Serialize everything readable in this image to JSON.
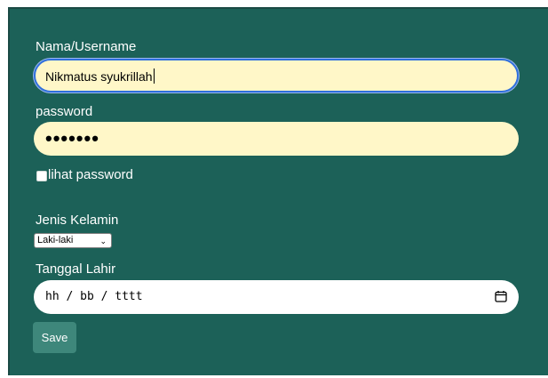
{
  "form": {
    "username": {
      "label": "Nama/Username",
      "value": "Nikmatus syukrillah"
    },
    "password": {
      "label": "password",
      "masked_value": "•••••••"
    },
    "show_password": {
      "label": "lihat password",
      "checked": false
    },
    "gender": {
      "label": "Jenis Kelamin",
      "selected": "Laki-laki"
    },
    "birth_date": {
      "label": "Tanggal Lahir",
      "placeholder": "hh / bb / tttt"
    },
    "save_label": "Save"
  },
  "colors": {
    "panel": "#1c6158",
    "input_fill": "#fff7c8",
    "focus_ring": "#2f6fdc",
    "button": "#3e877b"
  },
  "icons": {
    "date_picker": "calendar-icon",
    "select_arrow": "chevron-down-icon"
  }
}
